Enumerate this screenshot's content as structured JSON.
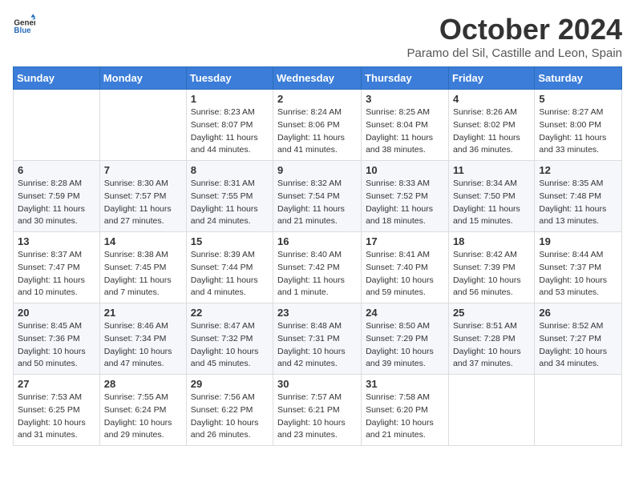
{
  "logo": {
    "general": "General",
    "blue": "Blue"
  },
  "title": {
    "month": "October 2024",
    "location": "Paramo del Sil, Castille and Leon, Spain"
  },
  "weekdays": [
    "Sunday",
    "Monday",
    "Tuesday",
    "Wednesday",
    "Thursday",
    "Friday",
    "Saturday"
  ],
  "weeks": [
    [
      {
        "day": "",
        "sunrise": "",
        "sunset": "",
        "daylight": ""
      },
      {
        "day": "",
        "sunrise": "",
        "sunset": "",
        "daylight": ""
      },
      {
        "day": "1",
        "sunrise": "Sunrise: 8:23 AM",
        "sunset": "Sunset: 8:07 PM",
        "daylight": "Daylight: 11 hours and 44 minutes."
      },
      {
        "day": "2",
        "sunrise": "Sunrise: 8:24 AM",
        "sunset": "Sunset: 8:06 PM",
        "daylight": "Daylight: 11 hours and 41 minutes."
      },
      {
        "day": "3",
        "sunrise": "Sunrise: 8:25 AM",
        "sunset": "Sunset: 8:04 PM",
        "daylight": "Daylight: 11 hours and 38 minutes."
      },
      {
        "day": "4",
        "sunrise": "Sunrise: 8:26 AM",
        "sunset": "Sunset: 8:02 PM",
        "daylight": "Daylight: 11 hours and 36 minutes."
      },
      {
        "day": "5",
        "sunrise": "Sunrise: 8:27 AM",
        "sunset": "Sunset: 8:00 PM",
        "daylight": "Daylight: 11 hours and 33 minutes."
      }
    ],
    [
      {
        "day": "6",
        "sunrise": "Sunrise: 8:28 AM",
        "sunset": "Sunset: 7:59 PM",
        "daylight": "Daylight: 11 hours and 30 minutes."
      },
      {
        "day": "7",
        "sunrise": "Sunrise: 8:30 AM",
        "sunset": "Sunset: 7:57 PM",
        "daylight": "Daylight: 11 hours and 27 minutes."
      },
      {
        "day": "8",
        "sunrise": "Sunrise: 8:31 AM",
        "sunset": "Sunset: 7:55 PM",
        "daylight": "Daylight: 11 hours and 24 minutes."
      },
      {
        "day": "9",
        "sunrise": "Sunrise: 8:32 AM",
        "sunset": "Sunset: 7:54 PM",
        "daylight": "Daylight: 11 hours and 21 minutes."
      },
      {
        "day": "10",
        "sunrise": "Sunrise: 8:33 AM",
        "sunset": "Sunset: 7:52 PM",
        "daylight": "Daylight: 11 hours and 18 minutes."
      },
      {
        "day": "11",
        "sunrise": "Sunrise: 8:34 AM",
        "sunset": "Sunset: 7:50 PM",
        "daylight": "Daylight: 11 hours and 15 minutes."
      },
      {
        "day": "12",
        "sunrise": "Sunrise: 8:35 AM",
        "sunset": "Sunset: 7:48 PM",
        "daylight": "Daylight: 11 hours and 13 minutes."
      }
    ],
    [
      {
        "day": "13",
        "sunrise": "Sunrise: 8:37 AM",
        "sunset": "Sunset: 7:47 PM",
        "daylight": "Daylight: 11 hours and 10 minutes."
      },
      {
        "day": "14",
        "sunrise": "Sunrise: 8:38 AM",
        "sunset": "Sunset: 7:45 PM",
        "daylight": "Daylight: 11 hours and 7 minutes."
      },
      {
        "day": "15",
        "sunrise": "Sunrise: 8:39 AM",
        "sunset": "Sunset: 7:44 PM",
        "daylight": "Daylight: 11 hours and 4 minutes."
      },
      {
        "day": "16",
        "sunrise": "Sunrise: 8:40 AM",
        "sunset": "Sunset: 7:42 PM",
        "daylight": "Daylight: 11 hours and 1 minute."
      },
      {
        "day": "17",
        "sunrise": "Sunrise: 8:41 AM",
        "sunset": "Sunset: 7:40 PM",
        "daylight": "Daylight: 10 hours and 59 minutes."
      },
      {
        "day": "18",
        "sunrise": "Sunrise: 8:42 AM",
        "sunset": "Sunset: 7:39 PM",
        "daylight": "Daylight: 10 hours and 56 minutes."
      },
      {
        "day": "19",
        "sunrise": "Sunrise: 8:44 AM",
        "sunset": "Sunset: 7:37 PM",
        "daylight": "Daylight: 10 hours and 53 minutes."
      }
    ],
    [
      {
        "day": "20",
        "sunrise": "Sunrise: 8:45 AM",
        "sunset": "Sunset: 7:36 PM",
        "daylight": "Daylight: 10 hours and 50 minutes."
      },
      {
        "day": "21",
        "sunrise": "Sunrise: 8:46 AM",
        "sunset": "Sunset: 7:34 PM",
        "daylight": "Daylight: 10 hours and 47 minutes."
      },
      {
        "day": "22",
        "sunrise": "Sunrise: 8:47 AM",
        "sunset": "Sunset: 7:32 PM",
        "daylight": "Daylight: 10 hours and 45 minutes."
      },
      {
        "day": "23",
        "sunrise": "Sunrise: 8:48 AM",
        "sunset": "Sunset: 7:31 PM",
        "daylight": "Daylight: 10 hours and 42 minutes."
      },
      {
        "day": "24",
        "sunrise": "Sunrise: 8:50 AM",
        "sunset": "Sunset: 7:29 PM",
        "daylight": "Daylight: 10 hours and 39 minutes."
      },
      {
        "day": "25",
        "sunrise": "Sunrise: 8:51 AM",
        "sunset": "Sunset: 7:28 PM",
        "daylight": "Daylight: 10 hours and 37 minutes."
      },
      {
        "day": "26",
        "sunrise": "Sunrise: 8:52 AM",
        "sunset": "Sunset: 7:27 PM",
        "daylight": "Daylight: 10 hours and 34 minutes."
      }
    ],
    [
      {
        "day": "27",
        "sunrise": "Sunrise: 7:53 AM",
        "sunset": "Sunset: 6:25 PM",
        "daylight": "Daylight: 10 hours and 31 minutes."
      },
      {
        "day": "28",
        "sunrise": "Sunrise: 7:55 AM",
        "sunset": "Sunset: 6:24 PM",
        "daylight": "Daylight: 10 hours and 29 minutes."
      },
      {
        "day": "29",
        "sunrise": "Sunrise: 7:56 AM",
        "sunset": "Sunset: 6:22 PM",
        "daylight": "Daylight: 10 hours and 26 minutes."
      },
      {
        "day": "30",
        "sunrise": "Sunrise: 7:57 AM",
        "sunset": "Sunset: 6:21 PM",
        "daylight": "Daylight: 10 hours and 23 minutes."
      },
      {
        "day": "31",
        "sunrise": "Sunrise: 7:58 AM",
        "sunset": "Sunset: 6:20 PM",
        "daylight": "Daylight: 10 hours and 21 minutes."
      },
      {
        "day": "",
        "sunrise": "",
        "sunset": "",
        "daylight": ""
      },
      {
        "day": "",
        "sunrise": "",
        "sunset": "",
        "daylight": ""
      }
    ]
  ]
}
